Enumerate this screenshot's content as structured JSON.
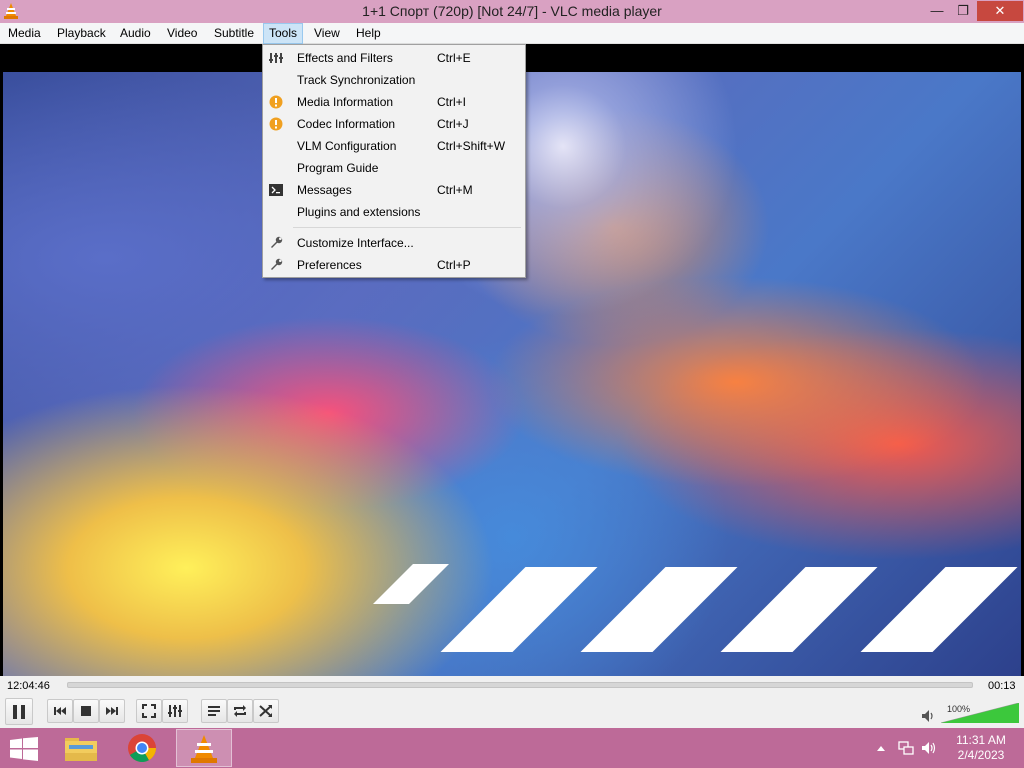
{
  "window": {
    "title": "1+1 Спорт (720p) [Not 24/7] - VLC media player",
    "minimize": "—",
    "restore": "❐",
    "close": "✕"
  },
  "menubar": {
    "items": [
      "Media",
      "Playback",
      "Audio",
      "Video",
      "Subtitle",
      "Tools",
      "View",
      "Help"
    ],
    "active": "Tools"
  },
  "tools_menu": {
    "items": [
      {
        "label": "Effects and Filters",
        "shortcut": "Ctrl+E",
        "icon": "equalizer-icon"
      },
      {
        "label": "Track Synchronization",
        "shortcut": "",
        "icon": ""
      },
      {
        "label": "Media Information",
        "shortcut": "Ctrl+I",
        "icon": "info-icon"
      },
      {
        "label": "Codec Information",
        "shortcut": "Ctrl+J",
        "icon": "info-icon"
      },
      {
        "label": "VLM Configuration",
        "shortcut": "Ctrl+Shift+W",
        "icon": ""
      },
      {
        "label": "Program Guide",
        "shortcut": "",
        "icon": ""
      },
      {
        "label": "Messages",
        "shortcut": "Ctrl+M",
        "icon": "terminal-icon"
      },
      {
        "label": "Plugins and extensions",
        "shortcut": "",
        "icon": ""
      },
      {
        "label": "Customize Interface...",
        "shortcut": "",
        "icon": "wrench-icon"
      },
      {
        "label": "Preferences",
        "shortcut": "Ctrl+P",
        "icon": "wrench-icon"
      }
    ]
  },
  "playback": {
    "elapsed": "12:04:46",
    "remaining": "00:13",
    "volume": "100%",
    "volume_level": 1.0
  },
  "taskbar": {
    "time": "11:31 AM",
    "date": "2/4/2023"
  },
  "colors": {
    "titlebar": "#d9a1c2",
    "taskbar": "#bd6a98",
    "info_icon": "#f0a020",
    "volume_green": "#3cc83c"
  }
}
